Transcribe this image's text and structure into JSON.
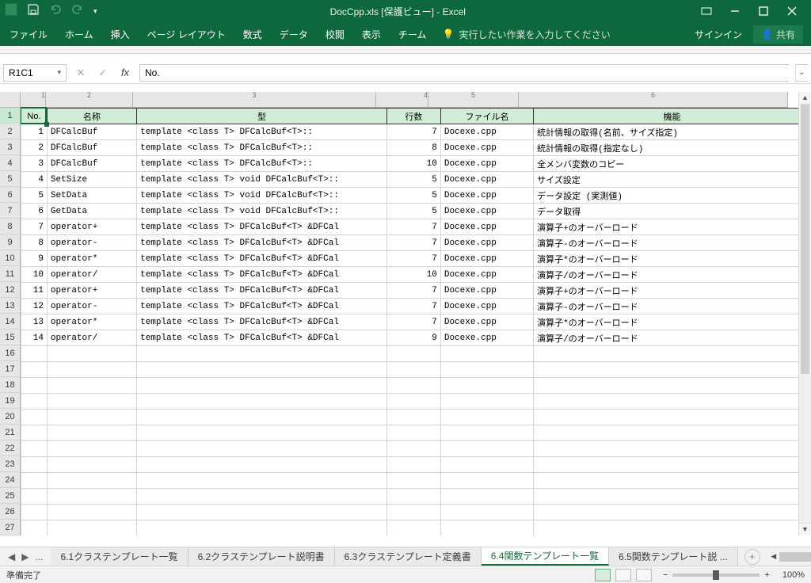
{
  "title": "DocCpp.xls [保護ビュー] - Excel",
  "ribbon": {
    "tabs": [
      "ファイル",
      "ホーム",
      "挿入",
      "ページ レイアウト",
      "数式",
      "データ",
      "校閲",
      "表示",
      "チーム"
    ],
    "tell_me": "実行したい作業を入力してください",
    "signin": "サインイン",
    "share": "共有"
  },
  "namebox": "R1C1",
  "formula_value": "No.",
  "col_numbers": [
    "1",
    "2",
    "3",
    "4",
    "5",
    "6"
  ],
  "header_cells": [
    "No.",
    "名称",
    "型",
    "行数",
    "ファイル名",
    "機能"
  ],
  "rows": [
    {
      "no": "1",
      "name": "DFCalcBuf",
      "type": "template <class T> DFCalcBuf<T>::",
      "lines": "7",
      "file": "Docexe.cpp",
      "func": "統計情報の取得(名前、サイズ指定)"
    },
    {
      "no": "2",
      "name": "DFCalcBuf",
      "type": "template <class T> DFCalcBuf<T>::",
      "lines": "8",
      "file": "Docexe.cpp",
      "func": "統計情報の取得(指定なし)"
    },
    {
      "no": "3",
      "name": "DFCalcBuf",
      "type": "template <class T> DFCalcBuf<T>::",
      "lines": "10",
      "file": "Docexe.cpp",
      "func": "全メンバ変数のコピー"
    },
    {
      "no": "4",
      "name": "SetSize",
      "type": "template <class T> void DFCalcBuf<T>::",
      "lines": "5",
      "file": "Docexe.cpp",
      "func": "サイズ設定"
    },
    {
      "no": "5",
      "name": "SetData",
      "type": "template <class T> void DFCalcBuf<T>::",
      "lines": "5",
      "file": "Docexe.cpp",
      "func": "データ設定 (実測値)"
    },
    {
      "no": "6",
      "name": "GetData",
      "type": "template <class T> void DFCalcBuf<T>::",
      "lines": "5",
      "file": "Docexe.cpp",
      "func": "データ取得"
    },
    {
      "no": "7",
      "name": "operator+",
      "type": "template <class T> DFCalcBuf<T> &DFCal",
      "lines": "7",
      "file": "Docexe.cpp",
      "func": "演算子+のオーバーロード"
    },
    {
      "no": "8",
      "name": "operator-",
      "type": "template <class T> DFCalcBuf<T> &DFCal",
      "lines": "7",
      "file": "Docexe.cpp",
      "func": "演算子-のオーバーロード"
    },
    {
      "no": "9",
      "name": "operator*",
      "type": "template <class T> DFCalcBuf<T> &DFCal",
      "lines": "7",
      "file": "Docexe.cpp",
      "func": "演算子*のオーバーロード"
    },
    {
      "no": "10",
      "name": "operator/",
      "type": "template <class T> DFCalcBuf<T> &DFCal",
      "lines": "10",
      "file": "Docexe.cpp",
      "func": "演算子/のオーバーロード"
    },
    {
      "no": "11",
      "name": "operator+",
      "type": "template <class T> DFCalcBuf<T> &DFCal",
      "lines": "7",
      "file": "Docexe.cpp",
      "func": "演算子+のオーバーロード"
    },
    {
      "no": "12",
      "name": "operator-",
      "type": "template <class T> DFCalcBuf<T> &DFCal",
      "lines": "7",
      "file": "Docexe.cpp",
      "func": "演算子-のオーバーロード"
    },
    {
      "no": "13",
      "name": "operator*",
      "type": "template <class T> DFCalcBuf<T> &DFCal",
      "lines": "7",
      "file": "Docexe.cpp",
      "func": "演算子*のオーバーロード"
    },
    {
      "no": "14",
      "name": "operator/",
      "type": "template <class T> DFCalcBuf<T> &DFCal",
      "lines": "9",
      "file": "Docexe.cpp",
      "func": "演算子/のオーバーロード"
    }
  ],
  "empty_row_count": 12,
  "row_header_max": 27,
  "sheet_tabs": {
    "ellipsis": "...",
    "items": [
      "6.1クラステンプレート一覧",
      "6.2クラステンプレート説明書",
      "6.3クラステンプレート定義書",
      "6.4関数テンプレート一覧",
      "6.5関数テンプレート説 ..."
    ],
    "active_index": 3
  },
  "status": {
    "ready": "準備完了",
    "zoom": "100%"
  }
}
